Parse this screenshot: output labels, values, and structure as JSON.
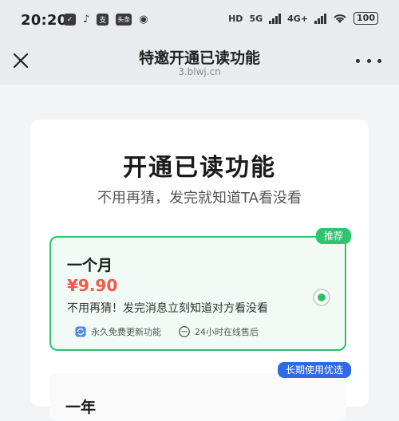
{
  "status_bar": {
    "time": "20:20",
    "left_icons": [
      "check-icon",
      "tiktok-icon",
      "alipay-icon",
      "toutiao-icon",
      "location-icon"
    ],
    "alipay_glyph": "支",
    "toutiao_text": "头条",
    "network_1": "5G",
    "network_2": "4G+",
    "hd_label": "HD",
    "battery": "100"
  },
  "nav": {
    "title": "特邀开通已读功能",
    "subtitle": "3.blwj.cn"
  },
  "card": {
    "title": "开通已读功能",
    "subtitle": "不用再猜，发完就知道TA看没看",
    "plans": [
      {
        "badge": "推荐",
        "name": "一个月",
        "price": "¥9.90",
        "description": "不用再猜！发完消息立刻知道对方看没看",
        "features": [
          "永久免费更新功能",
          "24小时在线售后"
        ],
        "selected": true
      },
      {
        "badge": "长期使用优选",
        "name": "一年"
      }
    ]
  },
  "colors": {
    "accent_green": "#2bc36a",
    "price_red": "#f05a4a",
    "badge_blue": "#2f6be4"
  }
}
